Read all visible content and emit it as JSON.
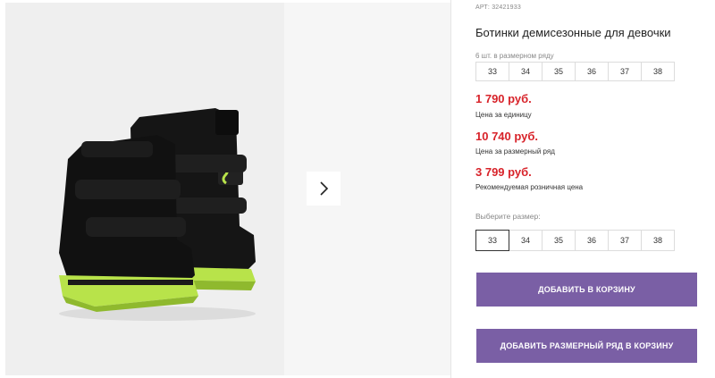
{
  "product": {
    "sku": "АРТ: 32421933",
    "title": "Ботинки демисезонные для девочки",
    "pack_label": "6 шт. в размерном ряду",
    "pack_sizes": [
      "33",
      "34",
      "35",
      "36",
      "37",
      "38"
    ]
  },
  "prices": [
    {
      "value": "1 790 руб.",
      "note": "Цена за единицу"
    },
    {
      "value": "10 740 руб.",
      "note": "Цена за размерный ряд"
    },
    {
      "value": "3 799 руб.",
      "note": "Рекомендуемая розничная цена"
    }
  ],
  "size_select": {
    "label": "Выберите размер:",
    "options": [
      "33",
      "34",
      "35",
      "36",
      "37",
      "38"
    ],
    "selected": "33"
  },
  "buttons": {
    "add_to_cart": "ДОБАВИТЬ В КОРЗИНУ",
    "add_pack_to_cart": "ДОБАВИТЬ РАЗМЕРНЫЙ РЯД В КОРЗИНУ"
  },
  "gallery": {
    "image": "black-boots-neon-green-sole",
    "next_icon": "chevron-right-icon"
  },
  "colors": {
    "price": "#d8232a",
    "button": "#7a5fa5",
    "sole_accent": "#b8e34a"
  }
}
